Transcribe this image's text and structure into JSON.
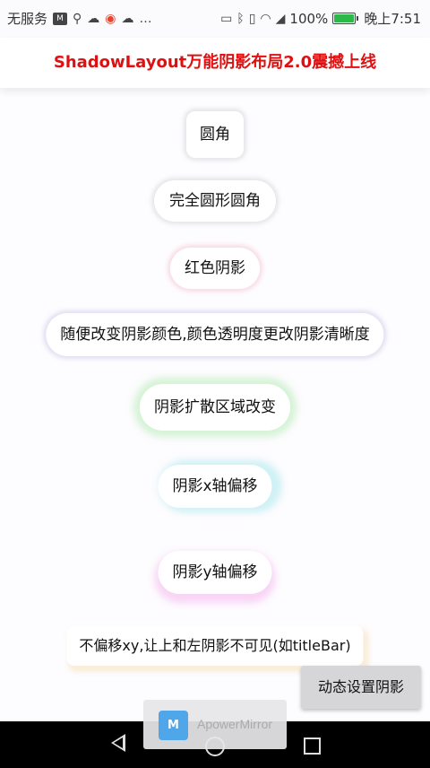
{
  "status_bar": {
    "carrier": "无服务",
    "battery": "100%",
    "battery_level": 1.0,
    "time": "晚上7:51",
    "more_icon": "…"
  },
  "title_bar": {
    "title": "ShadowLayout万能阴影布局2.0震撼上线",
    "title_color": "#e01010"
  },
  "items": [
    {
      "label": "圆角"
    },
    {
      "label": "完全圆形圆角"
    },
    {
      "label": "红色阴影"
    },
    {
      "label": "随便改变阴影颜色,颜色透明度更改阴影清晰度"
    },
    {
      "label": "阴影扩散区域改变"
    },
    {
      "label": "阴影x轴偏移"
    },
    {
      "label": "阴影y轴偏移"
    },
    {
      "label": "不偏移xy,让上和左阴影不可见(如titleBar)"
    }
  ],
  "floating_button": {
    "label": "动态设置阴影"
  },
  "overlay": {
    "app_name": "ApowerMirror"
  },
  "icons": {
    "status_left": [
      "app-badge-icon",
      "usb-icon",
      "cloud-icon",
      "weibo-icon",
      "cloud-download-icon"
    ],
    "status_right": [
      "cast-icon",
      "bluetooth-icon",
      "vibrate-icon",
      "wifi-icon",
      "signal-icon",
      "battery-icon"
    ],
    "nav": [
      "back-icon",
      "home-icon",
      "recent-apps-icon"
    ]
  }
}
